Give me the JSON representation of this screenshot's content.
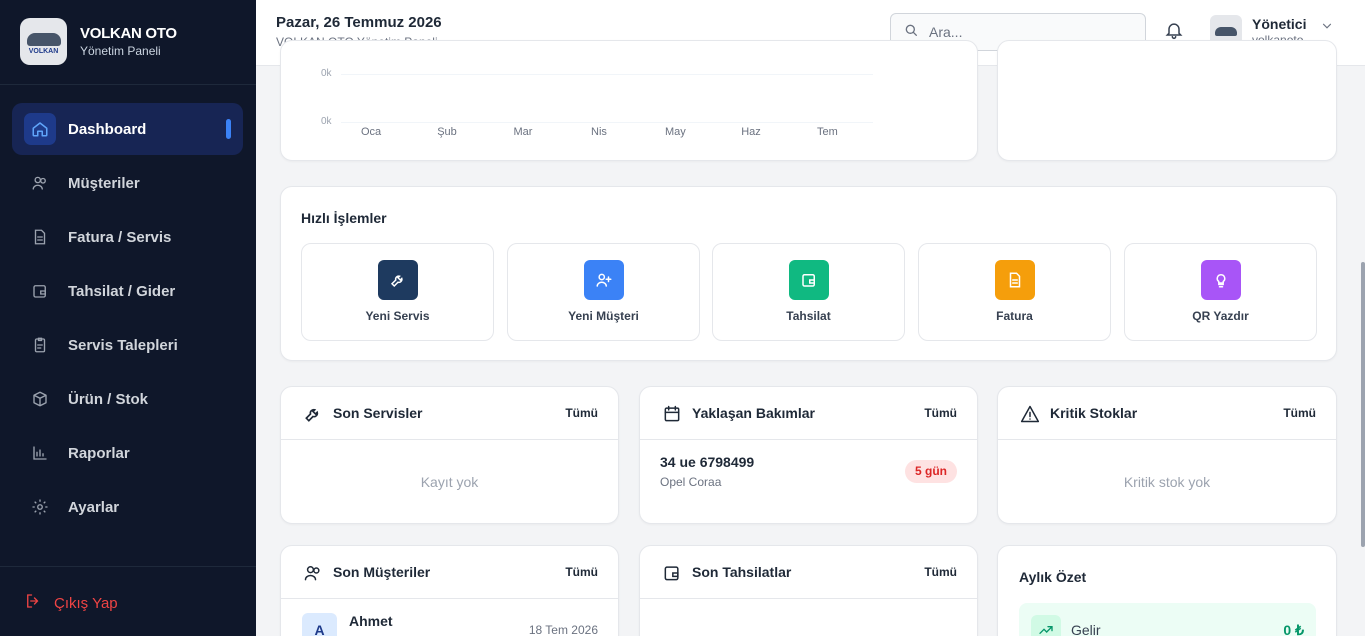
{
  "brand": {
    "title": "VOLKAN OTO",
    "subtitle": "Yönetim Paneli",
    "logo_text": "VOLKAN"
  },
  "nav": {
    "items": [
      {
        "label": "Dashboard",
        "icon": "home-icon",
        "active": true
      },
      {
        "label": "Müşteriler",
        "icon": "users-icon"
      },
      {
        "label": "Fatura / Servis",
        "icon": "document-icon"
      },
      {
        "label": "Tahsilat / Gider",
        "icon": "wallet-icon"
      },
      {
        "label": "Servis Talepleri",
        "icon": "clipboard-icon"
      },
      {
        "label": "Ürün / Stok",
        "icon": "box-icon"
      },
      {
        "label": "Raporlar",
        "icon": "bar-chart-icon"
      },
      {
        "label": "Ayarlar",
        "icon": "gear-icon"
      }
    ],
    "logout": "Çıkış Yap"
  },
  "header": {
    "date": "Pazar, 26 Temmuz 2026",
    "subtitle": "VOLKAN OTO Yönetim Paneli",
    "search_placeholder": "Ara...",
    "user_name": "Yönetici",
    "user_handle": "volkanoto"
  },
  "chart_data": {
    "type": "line",
    "categories": [
      "Oca",
      "Şub",
      "Mar",
      "Nis",
      "May",
      "Haz",
      "Tem"
    ],
    "y_ticks": [
      "0k",
      "0k"
    ],
    "series": [],
    "grid": true
  },
  "quick_actions": {
    "title": "Hızlı İşlemler",
    "items": [
      {
        "label": "Yeni Servis",
        "color": "#1e3a5f",
        "icon": "wrench-icon"
      },
      {
        "label": "Yeni Müşteri",
        "color": "#3b82f6",
        "icon": "user-plus-icon"
      },
      {
        "label": "Tahsilat",
        "color": "#10b981",
        "icon": "wallet-icon"
      },
      {
        "label": "Fatura",
        "color": "#f59e0b",
        "icon": "document-icon"
      },
      {
        "label": "QR Yazdır",
        "color": "#a855f7",
        "icon": "lightbulb-icon"
      }
    ]
  },
  "widgets": {
    "son_servisler": {
      "title": "Son Servisler",
      "all": "Tümü",
      "empty": "Kayıt yok"
    },
    "yaklasan_bakimlar": {
      "title": "Yaklaşan Bakımlar",
      "all": "Tümü",
      "items": [
        {
          "plate": "34 ue 6798499",
          "model": "Opel Coraa",
          "badge": "5 gün"
        }
      ]
    },
    "kritik_stoklar": {
      "title": "Kritik Stoklar",
      "all": "Tümü",
      "empty": "Kritik stok yok"
    },
    "son_musteriler": {
      "title": "Son Müşteriler",
      "all": "Tümü",
      "items": [
        {
          "initial": "A",
          "name": "Ahmet",
          "date": "18 Tem 2026"
        }
      ]
    },
    "son_tahsilatlar": {
      "title": "Son Tahsilatlar",
      "all": "Tümü"
    },
    "aylik_ozet": {
      "title": "Aylık Özet",
      "gelir_label": "Gelir",
      "gelir_value": "0 ₺"
    }
  },
  "colors": {
    "sidebar": "#0f172a",
    "accent": "#3b82f6",
    "danger": "#ef4444",
    "success": "#059669"
  }
}
